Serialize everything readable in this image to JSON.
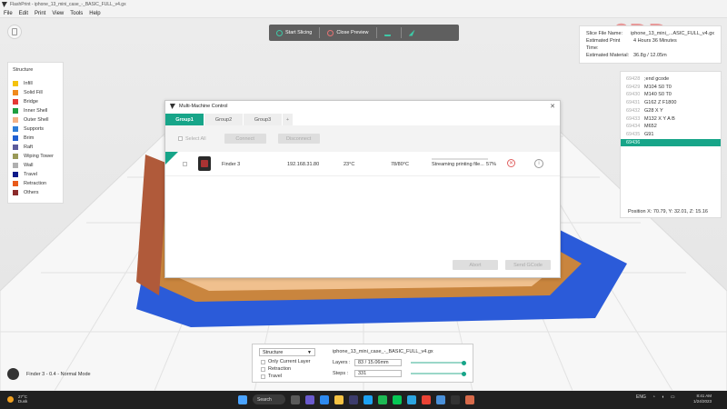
{
  "window": {
    "title": "FlashPrint - iphone_13_mini_case_-_BASIC_FULL_v4.gx"
  },
  "menu": [
    "File",
    "Edit",
    "Print",
    "View",
    "Tools",
    "Help"
  ],
  "logo": "3DD",
  "toolbar": {
    "start_slicing": "Start Slicing",
    "close_preview": "Close Preview"
  },
  "legend": {
    "title": "Structure",
    "items": [
      {
        "label": "Infill",
        "color": "#f4c20d"
      },
      {
        "label": "Solid Fill",
        "color": "#f08a1c"
      },
      {
        "label": "Bridge",
        "color": "#e53935"
      },
      {
        "label": "Inner Shell",
        "color": "#1e9e3e"
      },
      {
        "label": "Outer Shell",
        "color": "#f4b183"
      },
      {
        "label": "Supports",
        "color": "#2e7dd7"
      },
      {
        "label": "Brim",
        "color": "#1f5fd1"
      },
      {
        "label": "Raft",
        "color": "#5b5b9b"
      },
      {
        "label": "Wiping Tower",
        "color": "#9a9a58"
      },
      {
        "label": "Wall",
        "color": "#b0b0b0"
      },
      {
        "label": "Travel",
        "color": "#0d1b8a"
      },
      {
        "label": "Retraction",
        "color": "#e85a1a"
      },
      {
        "label": "Others",
        "color": "#8b2a2a"
      }
    ]
  },
  "slice_info": {
    "file_name_label": "Slice File Name:",
    "file_name": "iphone_13_mini_...ASIC_FULL_v4.gx",
    "time_label": "Estimated Print Time:",
    "time": "4 Hours 36 Minutes",
    "material_label": "Estimated Material:",
    "material": "36.8g / 12.05m"
  },
  "gcode": {
    "lines": [
      {
        "n": "69428",
        "text": ";end gcode",
        "selected": false
      },
      {
        "n": "69429",
        "text": "M104 S0 T0",
        "selected": false
      },
      {
        "n": "69430",
        "text": "M140 S0 T0",
        "selected": false
      },
      {
        "n": "69431",
        "text": "G162 Z F1800",
        "selected": false
      },
      {
        "n": "69432",
        "text": "G28 X Y",
        "selected": false
      },
      {
        "n": "69433",
        "text": "M132 X Y A B",
        "selected": false
      },
      {
        "n": "69434",
        "text": "M652",
        "selected": false
      },
      {
        "n": "69435",
        "text": "G91",
        "selected": false
      },
      {
        "n": "69436",
        "text": "",
        "selected": true
      }
    ],
    "position": "Position   X: 70.79, Y: 32.01, Z: 15.16"
  },
  "dialog": {
    "title": "Multi-Machine Control",
    "tabs": [
      "Group1",
      "Group2",
      "Group3",
      "+"
    ],
    "select_all": "Select All",
    "connect": "Connect",
    "disconnect": "Disconnect",
    "printer": {
      "name": "Finder 3",
      "ip": "192.168.31.80",
      "temp": "23°C",
      "temp2": "78/80°C",
      "status": "Streaming printing file...",
      "percent": "57%",
      "progress": 0.57
    },
    "abort": "Abort",
    "send_gcode": "Send GCode"
  },
  "bottom_panel": {
    "structure_select": "Structure",
    "only_current_layer": "Only Current Layer",
    "retraction": "Retraction",
    "travel": "Travel",
    "file_name": "iphone_13_mini_case_-_BASIC_FULL_v4.gx",
    "layers_label": "Layers :",
    "layers_value": "83 / 15.06mm",
    "steps_label": "Steps :",
    "steps_value": "331"
  },
  "printer_status": "Finder 3 - 0.4 - Normal Mode",
  "taskbar": {
    "temp": "27°C",
    "weather": "Dusk",
    "search": "Search",
    "lang": "ENG",
    "time": "8:41 AM",
    "date": "1/24/2023"
  }
}
